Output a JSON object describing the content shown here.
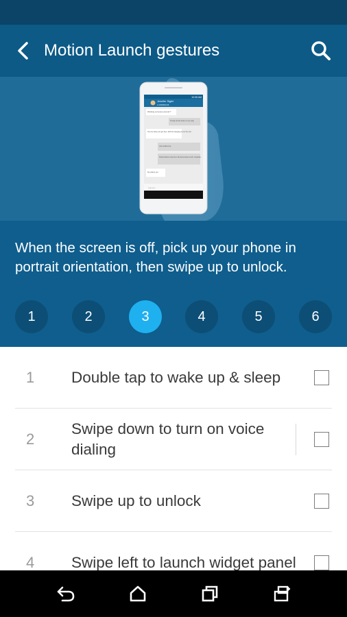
{
  "app_bar": {
    "title": "Motion Launch gestures",
    "back_icon": "back-arrow-icon",
    "search_icon": "search-icon"
  },
  "illustration": {
    "phone_header": {
      "time": "10:08 AM",
      "contact_name": "Jennifer Sigler",
      "contact_sub": "of 3858882238"
    },
    "messages": [
      {
        "text": "Working someone around ?",
        "side": "left"
      },
      {
        "text": "I'll stop at the store on my way",
        "side": "right"
      },
      {
        "text": "Text me when you get here. We'll be hanging out on the roof",
        "side": "left"
      },
      {
        "text": "Just pulled up",
        "side": "right"
      },
      {
        "text": "Stuck behind a slow bus. Be there before lunch, hopefully",
        "side": "right"
      },
      {
        "text": "No plans yet",
        "side": "left"
      }
    ],
    "input_placeholder": "Add text"
  },
  "hero": {
    "description": "When the screen is off, pick up your phone in portrait orientation, then swipe up to unlock.",
    "steps": [
      {
        "label": "1",
        "active": false
      },
      {
        "label": "2",
        "active": false
      },
      {
        "label": "3",
        "active": true
      },
      {
        "label": "4",
        "active": false
      },
      {
        "label": "5",
        "active": false
      },
      {
        "label": "6",
        "active": false
      }
    ]
  },
  "gestures": [
    {
      "num": "1",
      "label": "Double tap to wake up & sleep",
      "checked": false
    },
    {
      "num": "2",
      "label": "Swipe down to turn on voice dialing",
      "checked": false
    },
    {
      "num": "3",
      "label": "Swipe up to unlock",
      "checked": false
    },
    {
      "num": "4",
      "label": "Swipe left to launch widget panel",
      "checked": false
    }
  ],
  "nav_bar": {
    "back_icon": "nav-back-icon",
    "home_icon": "nav-home-icon",
    "recents_icon": "nav-recents-icon",
    "rotate_icon": "nav-rotate-icon"
  },
  "colors": {
    "status_bar": "#0b4467",
    "app_bar": "#0d5a87",
    "hero": "#0f5e8d",
    "step_inactive": "#0c4e75",
    "step_active": "#1fb0f0"
  }
}
